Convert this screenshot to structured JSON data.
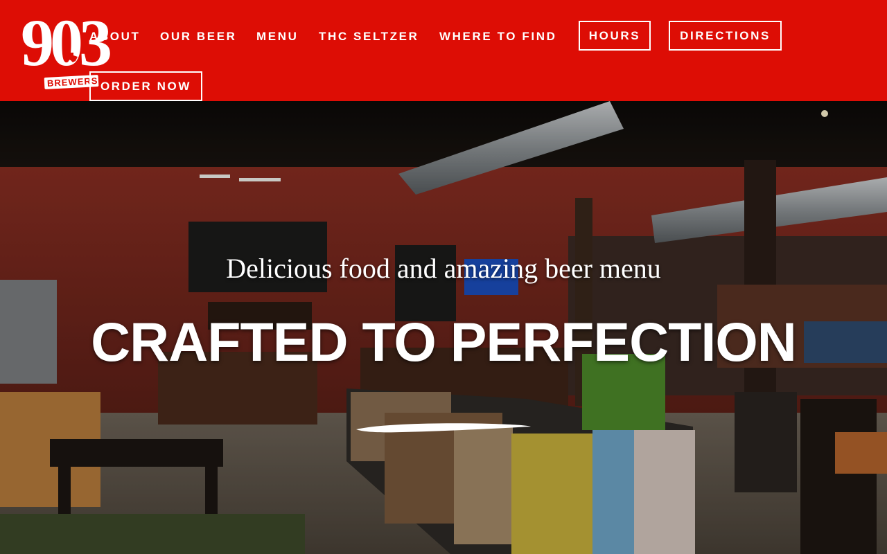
{
  "brand": {
    "logo_number": "903",
    "logo_word": "BREWERS",
    "color": "#dd0d05"
  },
  "nav": {
    "about": "ABOUT",
    "our_beer": "OUR BEER",
    "menu": "MENU",
    "thc_seltzer": "THC SELTZER",
    "where_to_find": "WHERE TO FIND",
    "hours": "HOURS",
    "directions": "DIRECTIONS",
    "order_now": "ORDER NOW"
  },
  "hero": {
    "subtitle": "Delicious food and amazing beer menu",
    "title": "CRAFTED TO PERFECTION"
  }
}
